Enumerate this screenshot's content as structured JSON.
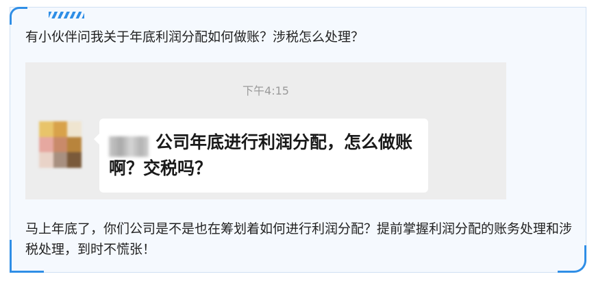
{
  "intro": "有小伙伴问我关于年底利润分配如何做账？涉税怎么处理？",
  "chat": {
    "time": "下午4:15",
    "message": "公司年底进行利润分配，怎么做账啊？交税吗？"
  },
  "outro": "马上年底了，你们公司是不是也在筹划着如何进行利润分配？提前掌握利润分配的账务处理和涉税处理，到时不慌张！",
  "colors": {
    "accent": "#2f8ee6",
    "card_background": "#f5f9fe",
    "chat_background": "#ededed"
  }
}
